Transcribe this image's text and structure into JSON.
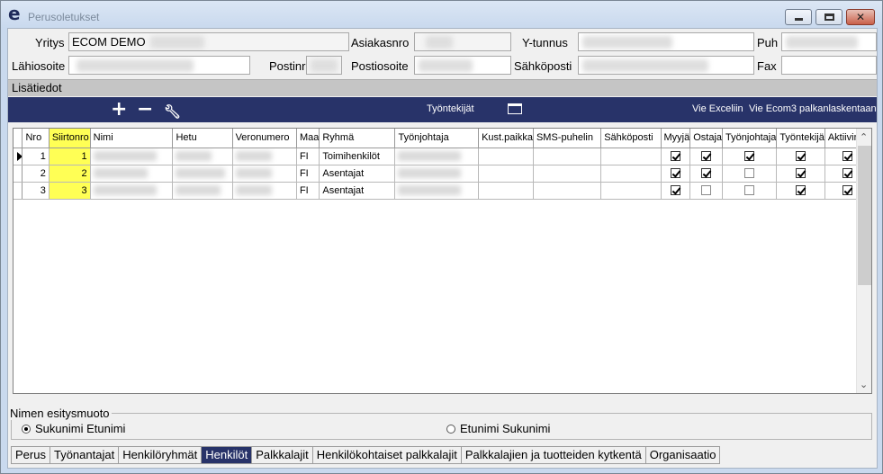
{
  "window": {
    "title": "Perusoletukset",
    "logo": "e"
  },
  "header": {
    "yritys_label": "Yritys",
    "yritys_value": "ECOM DEMO",
    "asiakasnro_label": "Asiakasnro",
    "ytunnus_label": "Y-tunnus",
    "puh_label": "Puh",
    "lahiosoite_label": "Lähiosoite",
    "postinro_label": "Postinro",
    "postiosoite_label": "Postiosoite",
    "sahkoposti_label": "Sähköposti",
    "fax_label": "Fax"
  },
  "section": {
    "title": "Lisätiedot"
  },
  "toolbar": {
    "add_icon": "+",
    "remove_icon": "−",
    "edit_icon": "wrench-icon",
    "center_label": "Työntekijät",
    "export_excel": "Vie Exceliin",
    "export_ecom3": "Vie Ecom3 palkanlaskentaan"
  },
  "grid": {
    "columns": [
      "Nro",
      "Siirtonro",
      "Nimi",
      "Hetu",
      "Veronumero",
      "Maa",
      "Ryhmä",
      "Työnjohtaja",
      "Kust.paikka",
      "SMS-puhelin",
      "Sähköposti",
      "Myyjä",
      "Ostaja",
      "Työnjohtaja",
      "Työntekijä",
      "Aktiivinen"
    ],
    "rows": [
      {
        "nro": "1",
        "siirtonro": "1",
        "maa": "FI",
        "ryhma": "Toimihenkilöt",
        "myyja": true,
        "ostaja": true,
        "tyonjohtaja": true,
        "tyontekija": true,
        "aktiivinen": true,
        "selected": true
      },
      {
        "nro": "2",
        "siirtonro": "2",
        "maa": "FI",
        "ryhma": "Asentajat",
        "myyja": true,
        "ostaja": true,
        "tyonjohtaja": false,
        "tyontekija": true,
        "aktiivinen": true,
        "selected": false
      },
      {
        "nro": "3",
        "siirtonro": "3",
        "maa": "FI",
        "ryhma": "Asentajat",
        "myyja": true,
        "ostaja": false,
        "tyonjohtaja": false,
        "tyontekija": true,
        "aktiivinen": true,
        "selected": false
      }
    ]
  },
  "name_format": {
    "legend": "Nimen esitysmuoto",
    "option1": "Sukunimi Etunimi",
    "option2": "Etunimi Sukunimi",
    "selected": "option1"
  },
  "tabs": [
    {
      "label": "Perus",
      "active": false
    },
    {
      "label": "Työnantajat",
      "active": false
    },
    {
      "label": "Henkilöryhmät",
      "active": false
    },
    {
      "label": "Henkilöt",
      "active": true
    },
    {
      "label": "Palkkalajit",
      "active": false
    },
    {
      "label": "Henkilökohtaiset palkkalajit",
      "active": false
    },
    {
      "label": "Palkkalajien ja tuotteiden kytkentä",
      "active": false
    },
    {
      "label": "Organisaatio",
      "active": false
    }
  ]
}
